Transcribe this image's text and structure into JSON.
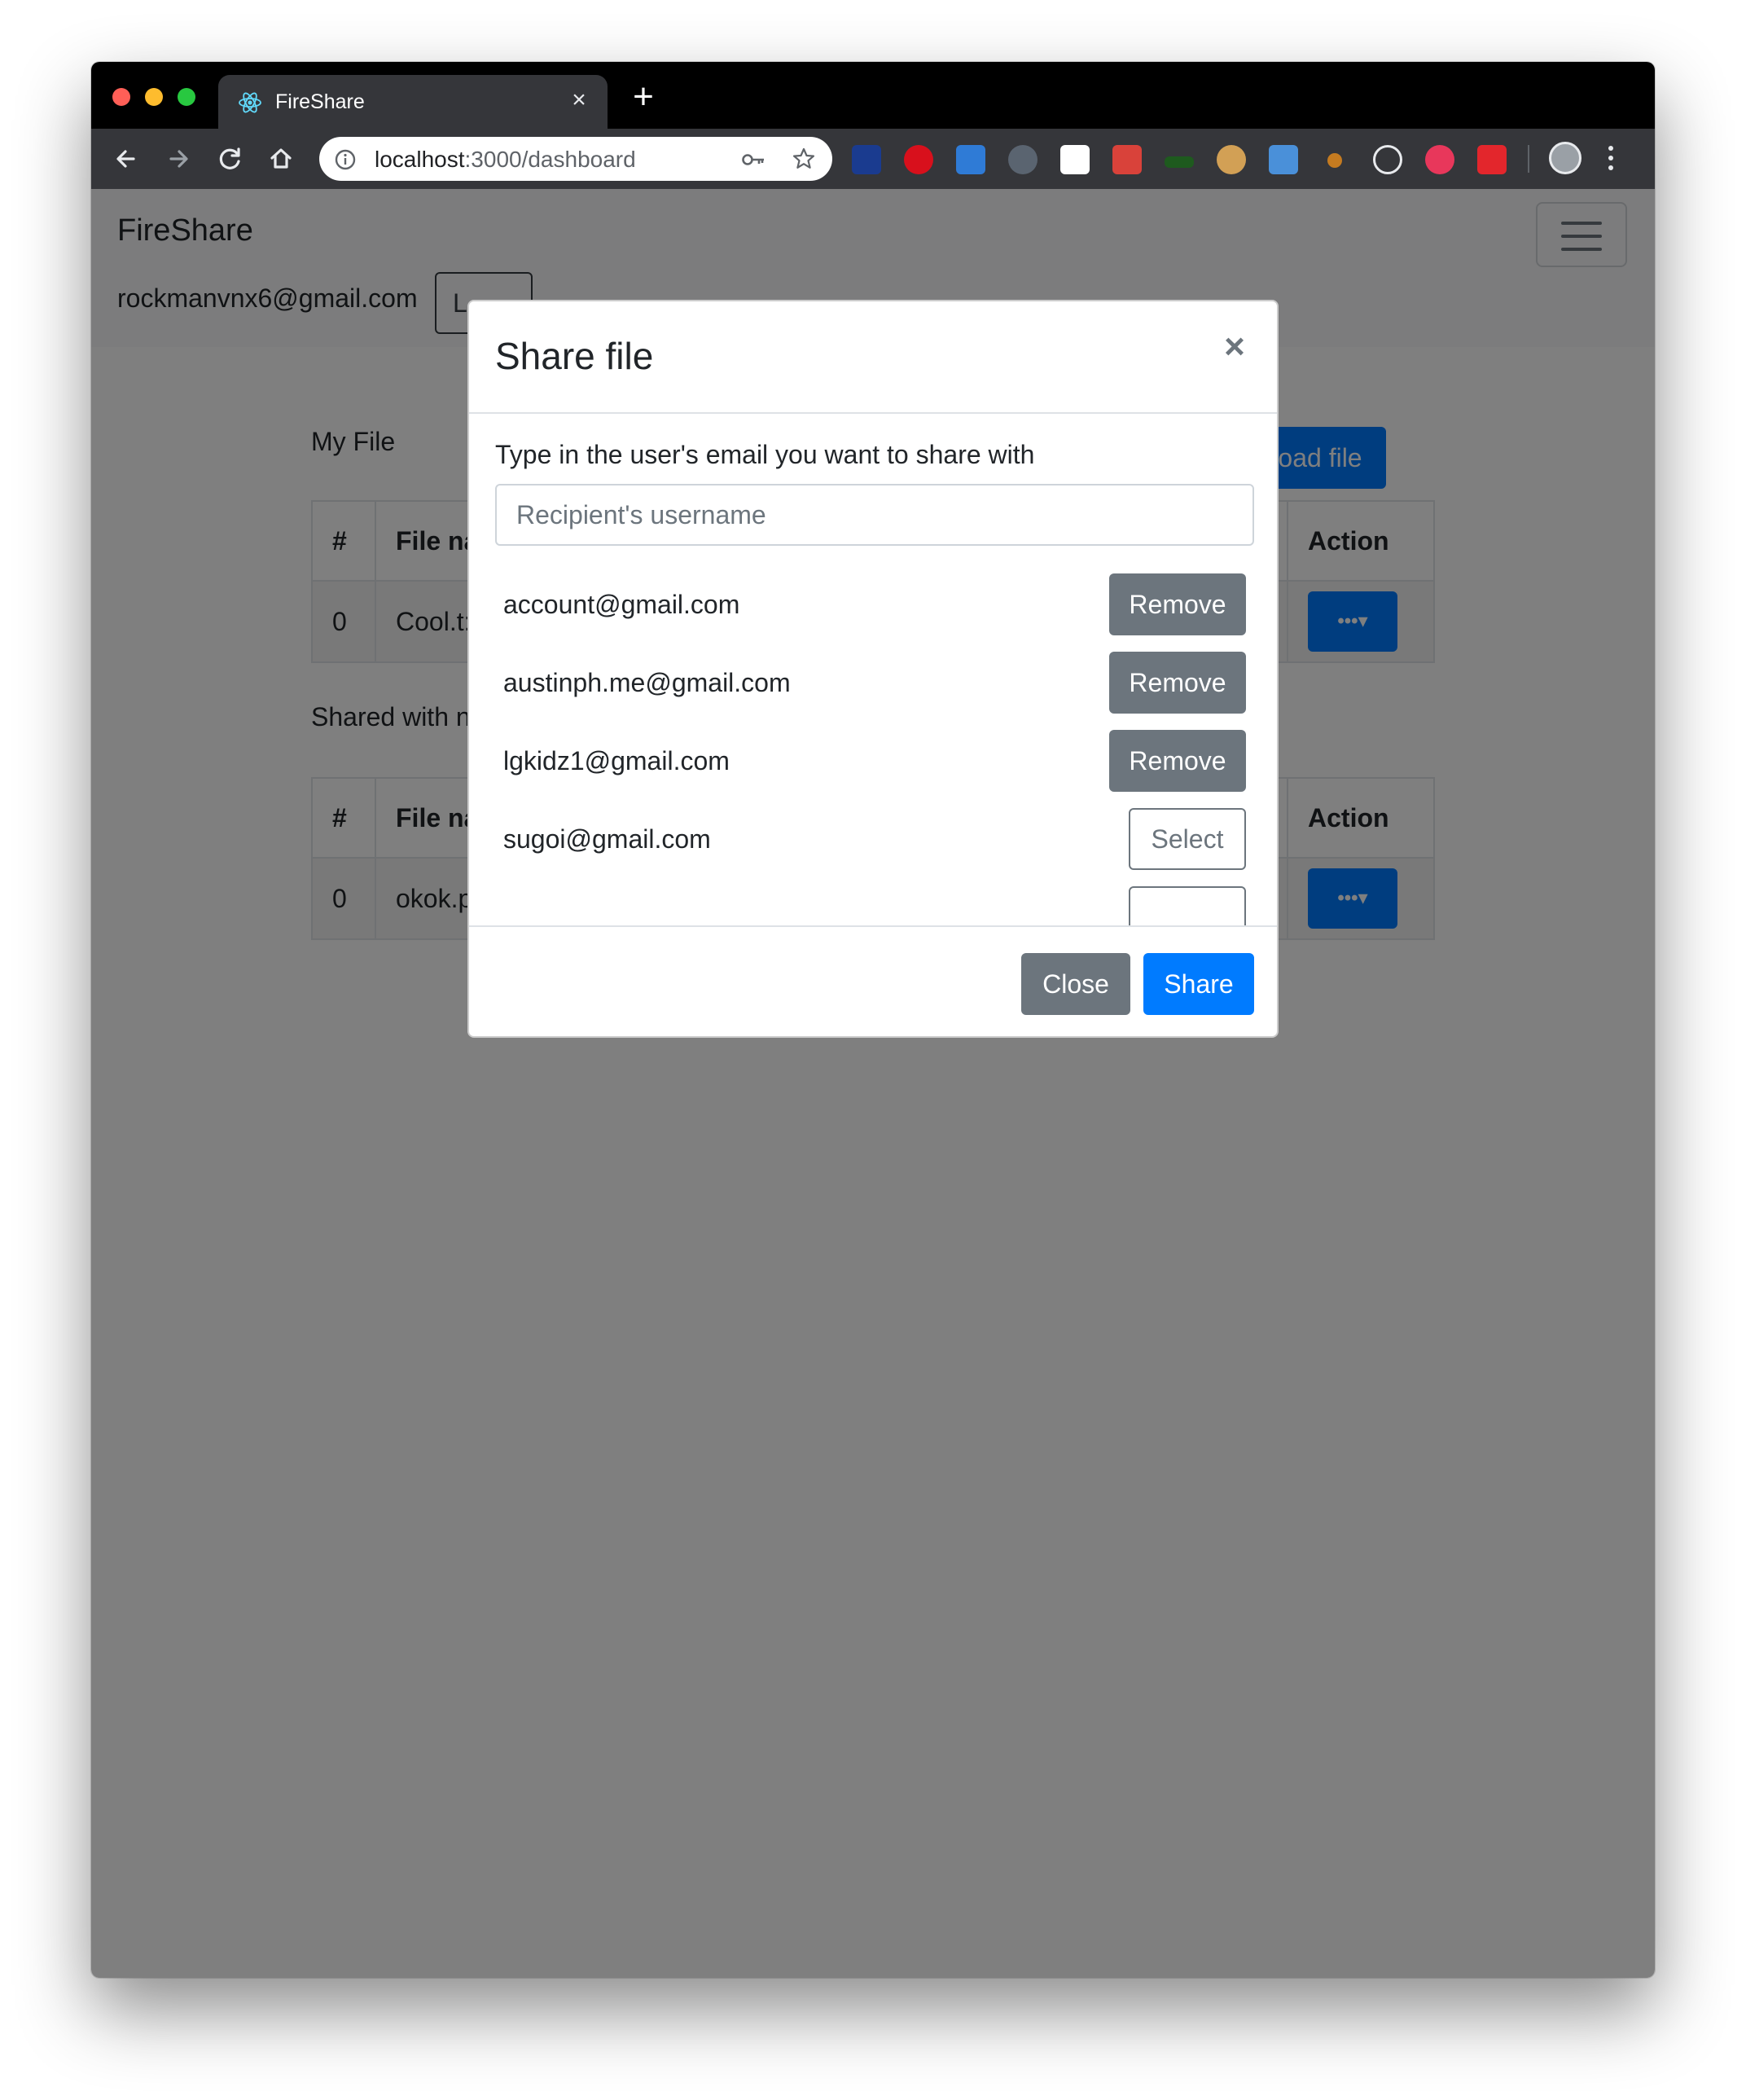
{
  "browser": {
    "tab_title": "FireShare",
    "tab_close": "×",
    "new_tab": "+",
    "url_host": "localhost",
    "url_path": ":3000/dashboard",
    "extension_icons": [
      "jetbrains-icon",
      "ublock-icon",
      "pocket-icon",
      "spy-icon",
      "instapaper-icon",
      "bug-icon",
      "terminal-icon",
      "cookie-icon",
      "reader-icon",
      "nut-icon",
      "ae-icon",
      "tampermonkey-icon",
      "pin-icon"
    ]
  },
  "navbar": {
    "brand": "FireShare",
    "user_email": "rockmanvnx6@gmail.com",
    "logout_label": "L"
  },
  "my_files": {
    "title": "My File",
    "upload_label": "Upload file",
    "headers": [
      "#",
      "File na",
      "Action"
    ],
    "rows": [
      {
        "num": "0",
        "name": "Cool.t:",
        "action_label": "•••▾"
      }
    ]
  },
  "shared_files": {
    "title": "Shared with n",
    "headers": [
      "#",
      "File na",
      "Action"
    ],
    "rows": [
      {
        "num": "0",
        "name": "okok.p",
        "action_label": "•••▾"
      }
    ]
  },
  "modal": {
    "title": "Share file",
    "close_symbol": "×",
    "prompt": "Type in the user's email you want to share with",
    "input_placeholder": "Recipient's username",
    "input_value": "",
    "users": [
      {
        "email": "account@gmail.com",
        "button": "Remove"
      },
      {
        "email": "austinph.me@gmail.com",
        "button": "Remove"
      },
      {
        "email": "lgkidz1@gmail.com",
        "button": "Remove"
      },
      {
        "email": "sugoi@gmail.com",
        "button": "Select"
      }
    ],
    "close_label": "Close",
    "share_label": "Share"
  },
  "colors": {
    "primary": "#007bff",
    "secondary": "#6c757d",
    "backdrop": "rgba(0,0,0,0.5)"
  }
}
